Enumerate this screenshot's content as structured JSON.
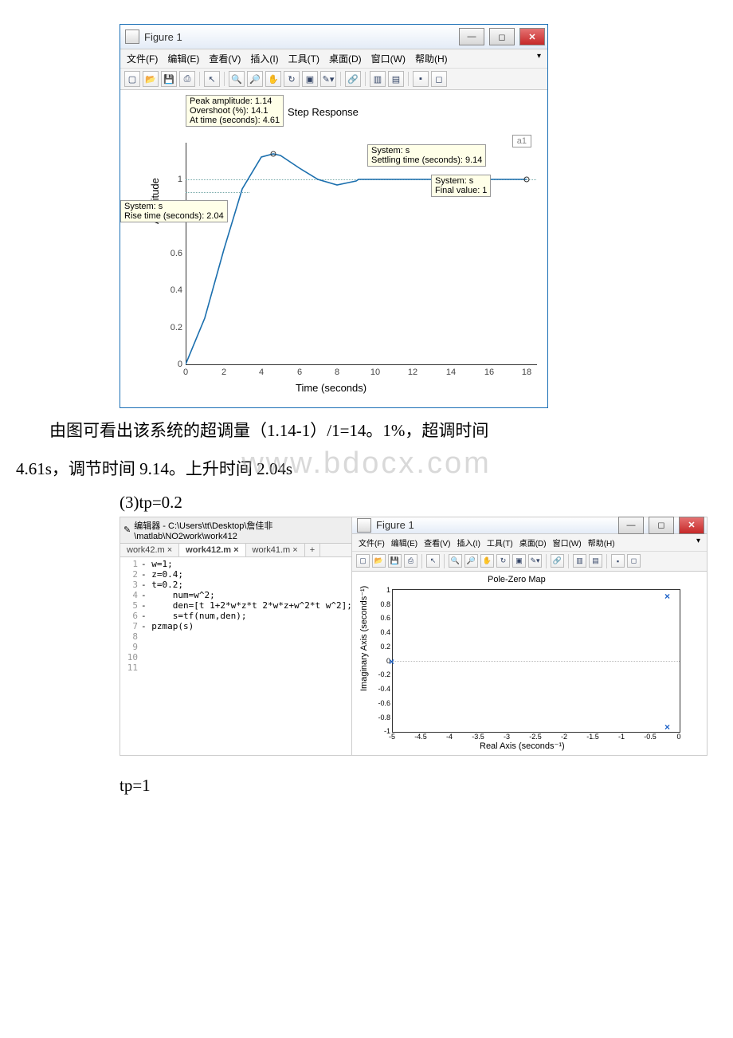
{
  "fig1": {
    "title": "Figure 1",
    "menu": [
      "文件(F)",
      "编辑(E)",
      "查看(V)",
      "插入(I)",
      "工具(T)",
      "桌面(D)",
      "窗口(W)",
      "帮助(H)"
    ],
    "plot_title": "Step Response",
    "xlabel": "Time (seconds)",
    "ylabel": "Amplitude",
    "legend": "a1",
    "tips": {
      "peak": "Peak amplitude: 1.14\nOvershoot (%): 14.1\nAt time (seconds): 4.61",
      "rise": "System: s\nRise time (seconds): 2.04",
      "settle": "System: s\nSettling time (seconds): 9.14",
      "final": "System: s\nFinal value: 1"
    },
    "yticks": [
      "0",
      "0.2",
      "0.4",
      "0.6",
      "1"
    ],
    "xticks": [
      "0",
      "2",
      "4",
      "6",
      "8",
      "10",
      "12",
      "14",
      "16",
      "18"
    ]
  },
  "para1a": "由图可看出该系统的超调量（1.14-1）/1=14。1%，超调时间",
  "para1b": "4.61s，调节时间 9.14。上升时间 2.04s",
  "watermark": "www.bdocx.com",
  "sub3": "(3)tp=0.2",
  "editor": {
    "title": "编辑器 - C:\\Users\\tt\\Desktop\\詹佳非\\matlab\\NO2work\\work412",
    "tabs": [
      "work42.m",
      "work412.m",
      "work41.m"
    ],
    "lines": [
      "w=1;",
      "z=0.4;",
      "t=0.2;",
      "    num=w^2;",
      "    den=[t 1+2*w*z*t 2*w*z+w^2*t w^2];",
      "    s=tf(num,den);",
      "pzmap(s)",
      "",
      "",
      "",
      ""
    ]
  },
  "fig2": {
    "title": "Figure 1",
    "menu": [
      "文件(F)",
      "编辑(E)",
      "查看(V)",
      "插入(I)",
      "工具(T)",
      "桌面(D)",
      "窗口(W)",
      "帮助(H)"
    ],
    "plot_title": "Pole-Zero Map",
    "xlabel": "Real Axis (seconds⁻¹)",
    "ylabel": "Imaginary Axis (seconds⁻¹)",
    "yticks": [
      "1",
      "0.8",
      "0.6",
      "0.4",
      "0.2",
      "0",
      "-0.2",
      "-0.4",
      "-0.6",
      "-0.8",
      "-1"
    ],
    "xticks": [
      "-5",
      "-4.5",
      "-4",
      "-3.5",
      "-3",
      "-2.5",
      "-2",
      "-1.5",
      "-1",
      "-0.5",
      "0"
    ]
  },
  "tp1": "tp=1",
  "chart_data": [
    {
      "type": "line",
      "title": "Step Response",
      "xlabel": "Time (seconds)",
      "ylabel": "Amplitude",
      "xlim": [
        0,
        18.5
      ],
      "ylim": [
        0,
        1.2
      ],
      "series": [
        {
          "name": "a1",
          "x": [
            0,
            1,
            2,
            3,
            4,
            4.61,
            5,
            6,
            7,
            8,
            9,
            9.14,
            10,
            12,
            14,
            16,
            18
          ],
          "y": [
            0,
            0.25,
            0.62,
            0.95,
            1.12,
            1.14,
            1.13,
            1.06,
            1.0,
            0.97,
            0.99,
            1.0,
            1.0,
            1.0,
            1.0,
            1.0,
            1.0
          ]
        }
      ],
      "annotations": {
        "peak_amplitude": 1.14,
        "overshoot_pct": 14.1,
        "peak_time": 4.61,
        "rise_time": 2.04,
        "settling_time": 9.14,
        "final_value": 1
      }
    },
    {
      "type": "scatter",
      "title": "Pole-Zero Map",
      "xlabel": "Real Axis (seconds^-1)",
      "ylabel": "Imaginary Axis (seconds^-1)",
      "xlim": [
        -5,
        0
      ],
      "ylim": [
        -1,
        1
      ],
      "poles": [
        {
          "re": -0.2,
          "im": 0.92
        },
        {
          "re": -0.2,
          "im": -0.92
        },
        {
          "re": -5,
          "im": 0
        }
      ]
    }
  ]
}
